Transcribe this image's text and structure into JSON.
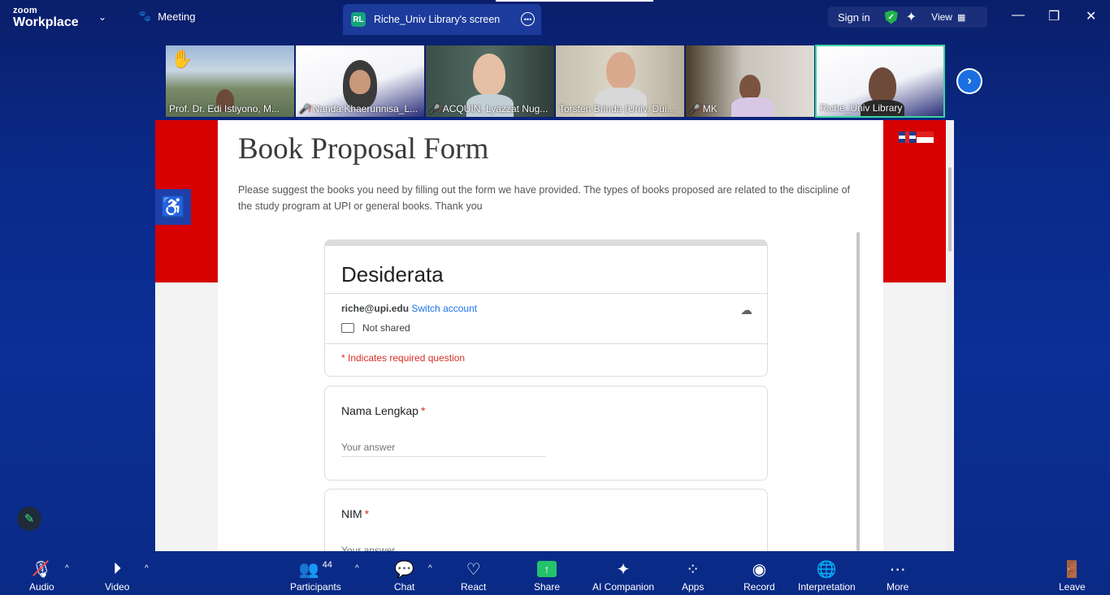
{
  "app": {
    "brand_top": "zoom",
    "brand_bottom": "Workplace"
  },
  "topbar": {
    "meeting_label": "Meeting",
    "share_tab_initials": "RL",
    "share_tab_label": "Riche_Univ Library's screen",
    "sign_in": "Sign in",
    "view": "View"
  },
  "participants_strip": [
    {
      "name": "Prof. Dr. Edi Istiyono, M...",
      "muted": false,
      "hand": true
    },
    {
      "name": "Nanda Khaerunnisa_L...",
      "muted": true
    },
    {
      "name": "ACQUIN, Lyazzat Nug...",
      "muted": true
    },
    {
      "name": "Torsten Brinda (Univ. Dui...",
      "muted": false
    },
    {
      "name": "MK",
      "muted": true
    },
    {
      "name": "Riche_Univ Library",
      "muted": false,
      "active": true
    }
  ],
  "shared": {
    "page_title": "Book Proposal Form",
    "page_desc": "Please suggest the books you need by filling out the form we have provided. The types of books proposed are related to the discipline of the study program at UPI or general books. Thank you",
    "form": {
      "title": "Desiderata",
      "email": "riche@upi.edu",
      "switch_account": "Switch account",
      "not_shared": "Not shared",
      "required_note": "* Indicates required question",
      "questions": [
        {
          "label": "Nama Lengkap",
          "star": "*",
          "placeholder": "Your answer"
        },
        {
          "label": "NIM",
          "star": "*",
          "placeholder": "Your answer"
        }
      ]
    }
  },
  "toolbar": {
    "audio": "Audio",
    "video": "Video",
    "participants": "Participants",
    "participants_count": "44",
    "chat": "Chat",
    "react": "React",
    "share": "Share",
    "ai_companion": "AI Companion",
    "apps": "Apps",
    "record": "Record",
    "interpretation": "Interpretation",
    "more": "More",
    "leave": "Leave"
  },
  "colors": {
    "accent_red": "#d60000",
    "share_green": "#23c26b",
    "active_border": "#39d6a0",
    "link_blue": "#1a73e8"
  }
}
